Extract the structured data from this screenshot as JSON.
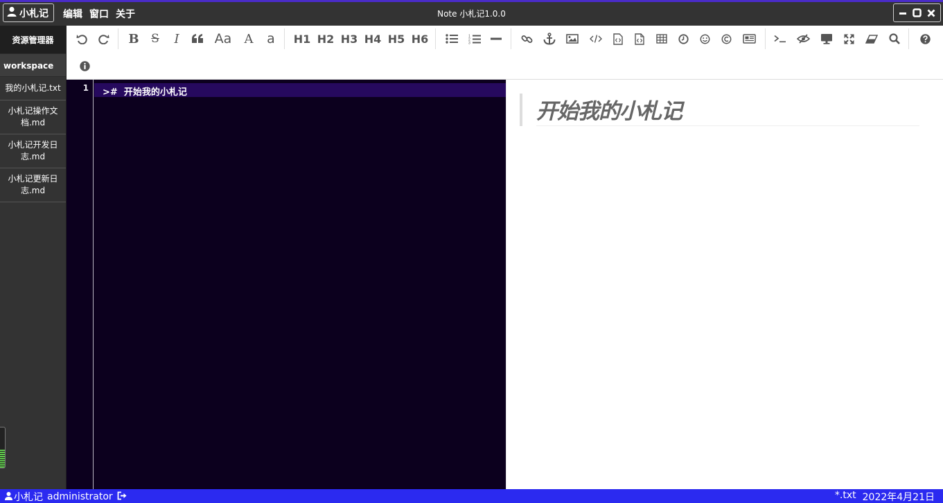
{
  "titlebar": {
    "app_name": "小札记",
    "menu": [
      "编辑",
      "窗口",
      "关于"
    ],
    "window_title": "Note 小札记1.0.0",
    "controls": [
      "minimize-icon",
      "maximize-icon",
      "close-icon"
    ]
  },
  "sidebar": {
    "header": "资源管理器",
    "workspace": "workspace",
    "files": [
      "我的小札记.txt",
      "小札记操作文档.md",
      "小札记开发日志.md",
      "小札记更新日志.md"
    ],
    "meter_level": 0.45
  },
  "toolbar": {
    "row1": [
      {
        "icon": "undo-icon"
      },
      {
        "icon": "redo-icon"
      },
      {
        "icon": "bold-icon"
      },
      {
        "icon": "strikethrough-icon"
      },
      {
        "icon": "italic-icon"
      },
      {
        "icon": "quote-icon"
      },
      {
        "icon": "uppercase-icon",
        "label": "Aa"
      },
      {
        "icon": "uppercase-a-icon",
        "label": "A"
      },
      {
        "icon": "lowercase-a-icon",
        "label": "a"
      },
      {
        "icon": "h1-icon",
        "label": "H1"
      },
      {
        "icon": "h2-icon",
        "label": "H2"
      },
      {
        "icon": "h3-icon",
        "label": "H3"
      },
      {
        "icon": "h4-icon",
        "label": "H4"
      },
      {
        "icon": "h5-icon",
        "label": "H5"
      },
      {
        "icon": "h6-icon",
        "label": "H6"
      },
      {
        "icon": "unordered-list-icon"
      },
      {
        "icon": "ordered-list-icon"
      },
      {
        "icon": "horizontal-rule-icon"
      },
      {
        "icon": "link-icon"
      },
      {
        "icon": "anchor-icon"
      },
      {
        "icon": "image-icon"
      },
      {
        "icon": "code-icon"
      },
      {
        "icon": "code-block-icon"
      },
      {
        "icon": "code-file-icon"
      },
      {
        "icon": "table-icon"
      },
      {
        "icon": "clock-icon"
      },
      {
        "icon": "emoji-icon"
      },
      {
        "icon": "copyright-icon"
      },
      {
        "icon": "newspaper-icon"
      },
      {
        "icon": "terminal-icon"
      },
      {
        "icon": "eye-slash-icon"
      },
      {
        "icon": "monitor-icon"
      },
      {
        "icon": "fullscreen-icon"
      },
      {
        "icon": "eraser-icon"
      },
      {
        "icon": "search-icon"
      },
      {
        "icon": "help-icon"
      }
    ],
    "row2": [
      {
        "icon": "info-icon"
      }
    ]
  },
  "editor": {
    "line_numbers": [
      "1"
    ],
    "lines": [
      ">#  开始我的小札记"
    ]
  },
  "preview": {
    "heading": "开始我的小札记"
  },
  "statusbar": {
    "app_name": "小札记",
    "user": "administrator",
    "file_type": "*.txt",
    "date": "2022年4月21日"
  },
  "colors": {
    "titlebar_bg": "#333333",
    "accent_top": "#4a2cc9",
    "editor_bg": "#0c001e",
    "active_line": "#26095e",
    "statusbar_bg": "#2b2af0"
  }
}
